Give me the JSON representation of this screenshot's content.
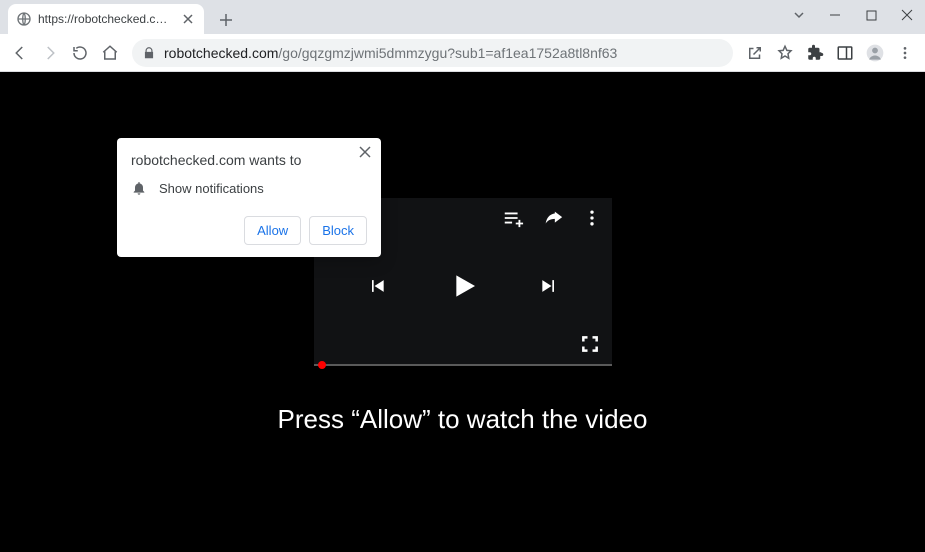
{
  "browser": {
    "tab_title": "https://robotchecked.com/go/gq",
    "url_domain": "robotchecked.com",
    "url_path": "/go/gqzgmzjwmi5dmmzygu?sub1=af1ea1752a8tl8nf63"
  },
  "prompt": {
    "title": "robotchecked.com wants to",
    "permission": "Show notifications",
    "allow": "Allow",
    "block": "Block"
  },
  "caption": "Press “Allow” to watch the video"
}
